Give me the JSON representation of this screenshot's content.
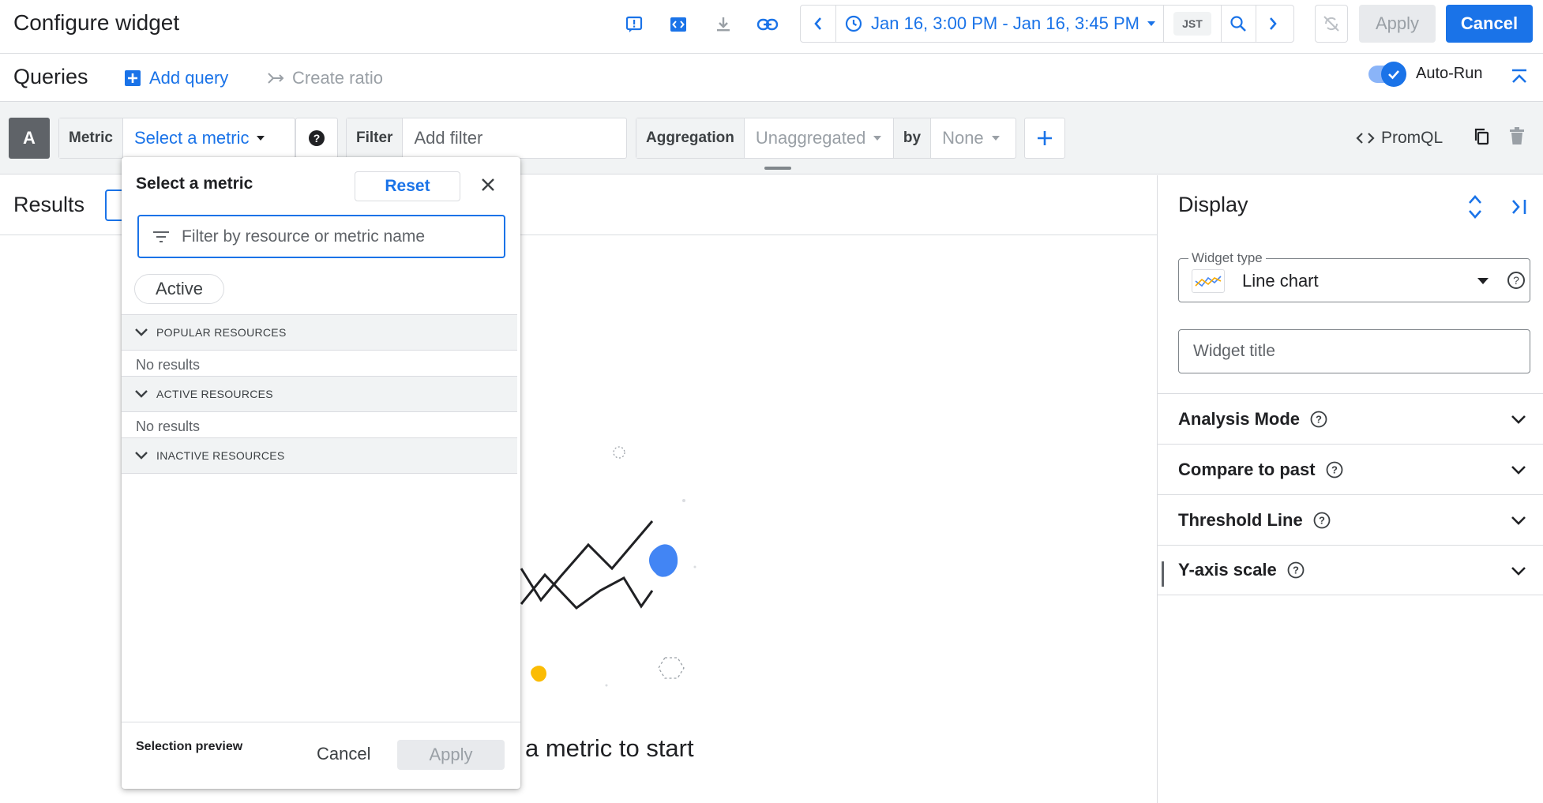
{
  "header": {
    "title": "Configure widget",
    "time_range": "Jan 16, 3:00 PM - Jan 16, 3:45 PM",
    "timezone": "JST",
    "apply_label": "Apply",
    "cancel_label": "Cancel"
  },
  "queries": {
    "title": "Queries",
    "add_query": "Add query",
    "create_ratio": "Create ratio",
    "auto_run": "Auto-Run",
    "auto_run_enabled": true
  },
  "query_row": {
    "letter": "A",
    "metric_label": "Metric",
    "metric_value": "Select a metric",
    "filter_label": "Filter",
    "filter_placeholder": "Add filter",
    "aggregation_label": "Aggregation",
    "aggregation_value": "Unaggregated",
    "by_label": "by",
    "by_value": "None",
    "promql_label": "PromQL"
  },
  "results": {
    "title": "Results",
    "empty_text": "a metric to start"
  },
  "display": {
    "title": "Display",
    "widget_type_label": "Widget type",
    "widget_type_value": "Line chart",
    "widget_title_placeholder": "Widget title",
    "sections": [
      {
        "label": "Analysis Mode"
      },
      {
        "label": "Compare to past"
      },
      {
        "label": "Threshold Line"
      },
      {
        "label": "Y-axis scale"
      }
    ]
  },
  "metric_popup": {
    "title": "Select a metric",
    "reset_label": "Reset",
    "filter_placeholder": "Filter by resource or metric name",
    "active_chip": "Active",
    "groups": [
      {
        "label": "POPULAR RESOURCES",
        "empty": "No results"
      },
      {
        "label": "ACTIVE RESOURCES",
        "empty": "No results"
      },
      {
        "label": "INACTIVE RESOURCES"
      }
    ],
    "selection_preview": "Selection preview",
    "cancel_label": "Cancel",
    "apply_label": "Apply"
  },
  "colors": {
    "accent": "#1a73e8",
    "disabled_bg": "#e8eaed",
    "header_bg": "#f1f3f4"
  },
  "icons": [
    "feedback-icon",
    "code-icon",
    "download-icon",
    "link-icon",
    "chevron-left-icon",
    "clock-icon",
    "zoom-icon",
    "chevron-right-icon",
    "sync-off-icon",
    "add-box-icon",
    "ratio-arrow-icon",
    "collapse-icon",
    "help-icon",
    "plus-icon",
    "code-brackets-icon",
    "copy-icon",
    "trash-icon",
    "expand-icon",
    "collapse-panel-icon",
    "line-chart-icon",
    "filter-icon",
    "close-icon",
    "chevron-down-icon"
  ]
}
